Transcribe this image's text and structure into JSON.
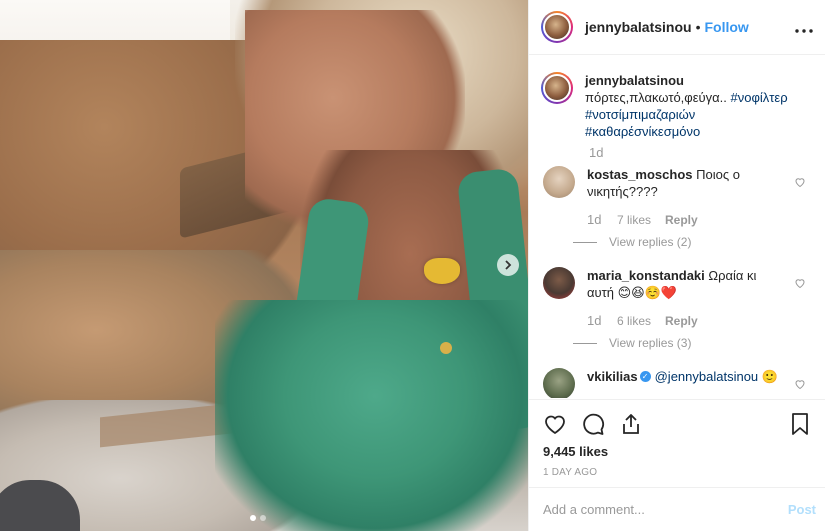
{
  "post": {
    "username": "jennybalatsinou",
    "follow_label": "Follow",
    "separator": "•",
    "more_label": "•••"
  },
  "caption": {
    "username": "jennybalatsinou",
    "text": "πόρτες,πλακωτό,φεύγα.. ",
    "hashtags": [
      "#νοφίλτερ",
      "#νοτσίμπιμαζαριών",
      "#καθαρέσνίκεσμόνο"
    ],
    "time": "1d"
  },
  "comments": [
    {
      "username": "kostas_moschos",
      "text": "Ποιος ο νικητής????",
      "time": "1d",
      "likes": "7 likes",
      "reply": "Reply",
      "view_replies": "View replies (2)"
    },
    {
      "username": "maria_konstandaki",
      "text": "Ωραία κι αυτή 😊😆☺️❤️",
      "time": "1d",
      "likes": "6 likes",
      "reply": "Reply",
      "view_replies": "View replies (3)"
    },
    {
      "username": "vkikilias",
      "mention": "@jennybalatsinou",
      "emoji": "🙂"
    }
  ],
  "actions": {
    "likes_count": "9,445 likes",
    "post_time": "1 DAY AGO",
    "like_icon": "heart-icon",
    "comment_icon": "comment-icon",
    "share_icon": "share-icon",
    "save_icon": "bookmark-icon"
  },
  "add_comment": {
    "placeholder": "Add a comment...",
    "post_label": "Post"
  },
  "colors": {
    "accent": "#3897f0",
    "hashtag": "#003569",
    "muted": "#999999",
    "post_disabled": "#b2dffc"
  }
}
